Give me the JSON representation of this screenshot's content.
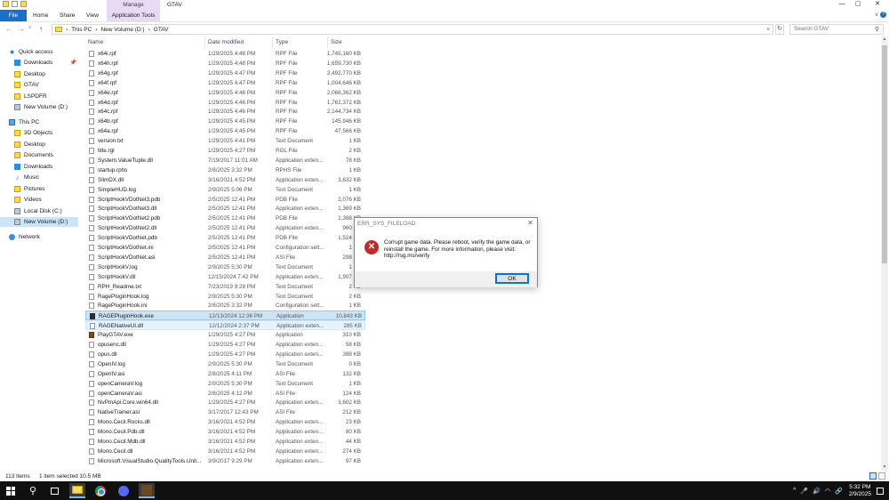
{
  "window": {
    "title": "GTAV",
    "manage_tab": "Manage",
    "controls": {
      "minimize": "—",
      "maximize": "▢",
      "close": "✕"
    }
  },
  "ribbon": {
    "tabs": [
      "File",
      "Home",
      "Share",
      "View",
      "Application Tools"
    ],
    "file_color": "#1a6fc7",
    "context_color": "#e8d9f5"
  },
  "address": {
    "back": "←",
    "forward": "→",
    "recent": "˅",
    "up": "↑",
    "crumbs": [
      "This PC",
      "New Volume (D:)",
      "GTAV"
    ],
    "separator": "›",
    "dropdown": "˅",
    "refresh": "↻",
    "search_placeholder": "Search GTAV"
  },
  "nav": {
    "items": [
      {
        "label": "Quick access",
        "icon": "star-icon"
      },
      {
        "label": "Downloads",
        "icon": "download-icon",
        "pinned": true
      },
      {
        "label": "Desktop",
        "icon": "folder-icon"
      },
      {
        "label": "GTAV",
        "icon": "folder-icon"
      },
      {
        "label": "LSPDFR",
        "icon": "folder-icon"
      },
      {
        "label": "New Volume (D:)",
        "icon": "drive-icon"
      },
      {
        "label": "This PC",
        "icon": "computer-icon"
      },
      {
        "label": "3D Objects",
        "icon": "folder-icon"
      },
      {
        "label": "Desktop",
        "icon": "folder-icon"
      },
      {
        "label": "Documents",
        "icon": "folder-icon"
      },
      {
        "label": "Downloads",
        "icon": "download-icon"
      },
      {
        "label": "Music",
        "icon": "music-icon"
      },
      {
        "label": "Pictures",
        "icon": "folder-icon"
      },
      {
        "label": "Videos",
        "icon": "folder-icon"
      },
      {
        "label": "Local Disk (C:)",
        "icon": "drive-icon"
      },
      {
        "label": "New Volume (D:)",
        "icon": "drive-icon",
        "selected": true
      },
      {
        "label": "Network",
        "icon": "network-icon"
      }
    ]
  },
  "columns": {
    "name": "Name",
    "date": "Date modified",
    "type": "Type",
    "size": "Size"
  },
  "files": [
    {
      "name": "x64i.rpf",
      "date": "1/29/2025 4:48 PM",
      "type": "RPF File",
      "size": "1,745,160 KB"
    },
    {
      "name": "x64h.rpf",
      "date": "1/29/2025 4:48 PM",
      "type": "RPF File",
      "size": "1,659,730 KB"
    },
    {
      "name": "x64g.rpf",
      "date": "1/29/2025 4:47 PM",
      "type": "RPF File",
      "size": "2,492,770 KB"
    },
    {
      "name": "x64f.rpf",
      "date": "1/29/2025 4:47 PM",
      "type": "RPF File",
      "size": "1,004,646 KB"
    },
    {
      "name": "x64e.rpf",
      "date": "1/29/2025 4:46 PM",
      "type": "RPF File",
      "size": "2,066,362 KB"
    },
    {
      "name": "x64d.rpf",
      "date": "1/29/2025 4:46 PM",
      "type": "RPF File",
      "size": "1,762,372 KB"
    },
    {
      "name": "x64c.rpf",
      "date": "1/29/2025 4:46 PM",
      "type": "RPF File",
      "size": "2,144,734 KB"
    },
    {
      "name": "x64b.rpf",
      "date": "1/29/2025 4:45 PM",
      "type": "RPF File",
      "size": "145,946 KB"
    },
    {
      "name": "x64a.rpf",
      "date": "1/29/2025 4:45 PM",
      "type": "RPF File",
      "size": "47,566 KB"
    },
    {
      "name": "version.txt",
      "date": "1/29/2025 4:41 PM",
      "type": "Text Document",
      "size": "1 KB"
    },
    {
      "name": "title.rgl",
      "date": "1/29/2025 4:27 PM",
      "type": "RGL File",
      "size": "2 KB"
    },
    {
      "name": "System.ValueTuple.dll",
      "date": "7/19/2017 11:01 AM",
      "type": "Application exten...",
      "size": "78 KB"
    },
    {
      "name": "startup.rphs",
      "date": "2/8/2025 3:32 PM",
      "type": "RPHS File",
      "size": "1 KB"
    },
    {
      "name": "SlimDX.dll",
      "date": "3/16/2021 4:52 PM",
      "type": "Application exten...",
      "size": "3,632 KB"
    },
    {
      "name": "SimpleHUD.log",
      "date": "2/9/2025 5:06 PM",
      "type": "Text Document",
      "size": "1 KB"
    },
    {
      "name": "ScriptHookVDotNet3.pdb",
      "date": "2/5/2025 12:41 PM",
      "type": "PDB File",
      "size": "2,076 KB"
    },
    {
      "name": "ScriptHookVDotNet3.dll",
      "date": "2/5/2025 12:41 PM",
      "type": "Application exten...",
      "size": "1,369 KB"
    },
    {
      "name": "ScriptHookVDotNet2.pdb",
      "date": "2/5/2025 12:41 PM",
      "type": "PDB File",
      "size": "1,398 KB"
    },
    {
      "name": "ScriptHookVDotNet2.dll",
      "date": "2/5/2025 12:41 PM",
      "type": "Application exten...",
      "size": "960 KB"
    },
    {
      "name": "ScriptHookVDotNet.pdb",
      "date": "2/5/2025 12:41 PM",
      "type": "PDB File",
      "size": "1,524 KB"
    },
    {
      "name": "ScriptHookVDotNet.ini",
      "date": "2/5/2025 12:41 PM",
      "type": "Configuration sett...",
      "size": "1 KB"
    },
    {
      "name": "ScriptHookVDotNet.asi",
      "date": "2/5/2025 12:41 PM",
      "type": "ASI File",
      "size": "298 KB"
    },
    {
      "name": "ScriptHookV.log",
      "date": "2/9/2025 5:30 PM",
      "type": "Text Document",
      "size": "1 KB"
    },
    {
      "name": "ScriptHookV.dll",
      "date": "12/15/2024 7:42 PM",
      "type": "Application exten...",
      "size": "1,907 KB"
    },
    {
      "name": "RPH_Readme.txt",
      "date": "7/23/2019 9:28 PM",
      "type": "Text Document",
      "size": "2 KB"
    },
    {
      "name": "RagePluginHook.log",
      "date": "2/9/2025 5:30 PM",
      "type": "Text Document",
      "size": "2 KB"
    },
    {
      "name": "RagePluginHook.ini",
      "date": "2/8/2025 3:32 PM",
      "type": "Configuration sett...",
      "size": "1 KB"
    },
    {
      "name": "RAGEPluginHook.exe",
      "date": "12/13/2024 12:36 PM",
      "type": "Application",
      "size": "10,843 KB",
      "state": "selected",
      "icon": "exe"
    },
    {
      "name": "RAGENativeUI.dll",
      "date": "12/12/2024 2:37 PM",
      "type": "Application exten...",
      "size": "285 KB",
      "state": "hovered"
    },
    {
      "name": "PlayGTAV.exe",
      "date": "1/29/2025 4:27 PM",
      "type": "Application",
      "size": "310 KB",
      "icon": "exe2"
    },
    {
      "name": "opusenc.dll",
      "date": "1/29/2025 4:27 PM",
      "type": "Application exten...",
      "size": "58 KB"
    },
    {
      "name": "opus.dll",
      "date": "1/29/2025 4:27 PM",
      "type": "Application exten...",
      "size": "398 KB"
    },
    {
      "name": "OpenIV.log",
      "date": "2/9/2025 5:30 PM",
      "type": "Text Document",
      "size": "0 KB"
    },
    {
      "name": "OpenIV.asi",
      "date": "2/8/2025 4:11 PM",
      "type": "ASI File",
      "size": "132 KB"
    },
    {
      "name": "openCameraV.log",
      "date": "2/9/2025 5:30 PM",
      "type": "Text Document",
      "size": "1 KB"
    },
    {
      "name": "openCameraV.asi",
      "date": "2/8/2025 4:12 PM",
      "type": "ASI File",
      "size": "124 KB"
    },
    {
      "name": "NvPmApi.Core.win64.dll",
      "date": "1/29/2025 4:27 PM",
      "type": "Application exten...",
      "size": "3,602 KB"
    },
    {
      "name": "NativeTrainer.asi",
      "date": "3/17/2017 12:43 PM",
      "type": "ASI File",
      "size": "212 KB"
    },
    {
      "name": "Mono.Cecil.Rocks.dll",
      "date": "3/16/2021 4:52 PM",
      "type": "Application exten...",
      "size": "23 KB"
    },
    {
      "name": "Mono.Cecil.Pdb.dll",
      "date": "3/16/2021 4:52 PM",
      "type": "Application exten...",
      "size": "80 KB"
    },
    {
      "name": "Mono.Cecil.Mdb.dll",
      "date": "3/16/2021 4:52 PM",
      "type": "Application exten...",
      "size": "44 KB"
    },
    {
      "name": "Mono.Cecil.dll",
      "date": "3/16/2021 4:52 PM",
      "type": "Application exten...",
      "size": "274 KB"
    },
    {
      "name": "Microsoft.VisualStudio.QualityTools.Unit...",
      "date": "3/9/2017 9:29 PM",
      "type": "Application exten...",
      "size": "97 KB"
    }
  ],
  "status": {
    "count": "113 items",
    "selection": "1 item selected  10.5 MB"
  },
  "dialog": {
    "title": "ERR_SYS_FILELOAD",
    "close": "✕",
    "error_glyph": "✕",
    "message": "Corrupt game data. Please reboot, verify the game data, or reinstall the game. For more information, please visit: http://rsg.ms/verify",
    "ok_label": "OK"
  },
  "taskbar": {
    "search_glyph": "⚲",
    "tray": {
      "chevron": "^",
      "mic": "🎤",
      "volume": "🔊",
      "wifi": "◠",
      "link": "🔗",
      "time": "5:32 PM",
      "date": "2/9/2025"
    }
  }
}
